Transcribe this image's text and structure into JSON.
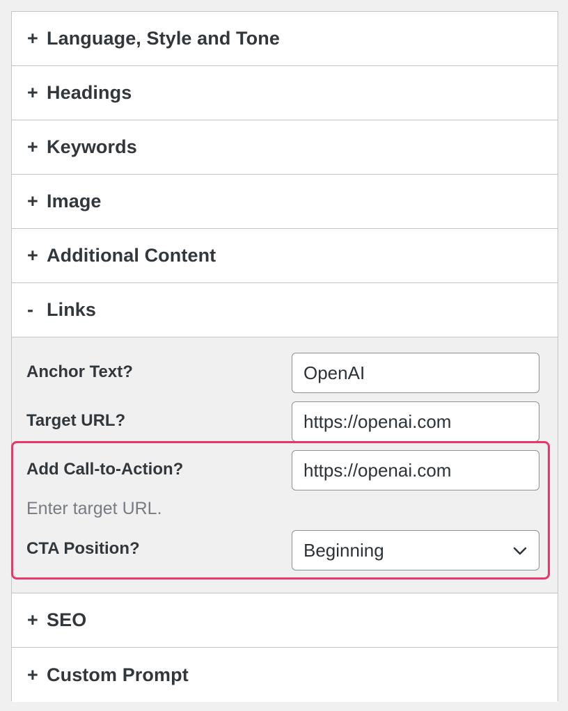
{
  "sections_top": [
    {
      "toggle": "+",
      "label": "Language, Style and Tone"
    },
    {
      "toggle": "+",
      "label": "Headings"
    },
    {
      "toggle": "+",
      "label": "Keywords"
    },
    {
      "toggle": "+",
      "label": "Image"
    },
    {
      "toggle": "+",
      "label": "Additional Content"
    },
    {
      "toggle": "-",
      "label": "Links"
    }
  ],
  "links": {
    "anchor_text": {
      "label": "Anchor Text?",
      "value": "OpenAI"
    },
    "target_url": {
      "label": "Target URL?",
      "value": "https://openai.com"
    },
    "cta": {
      "label": "Add Call-to-Action?",
      "value": "https://openai.com",
      "hint": "Enter target URL."
    },
    "cta_position": {
      "label": "CTA Position?",
      "selected": "Beginning"
    }
  },
  "sections_bottom": [
    {
      "toggle": "+",
      "label": "SEO"
    },
    {
      "toggle": "+",
      "label": "Custom Prompt"
    }
  ],
  "colors": {
    "highlight_border": "#e8386a",
    "panel_background": "#f0f0f1"
  }
}
